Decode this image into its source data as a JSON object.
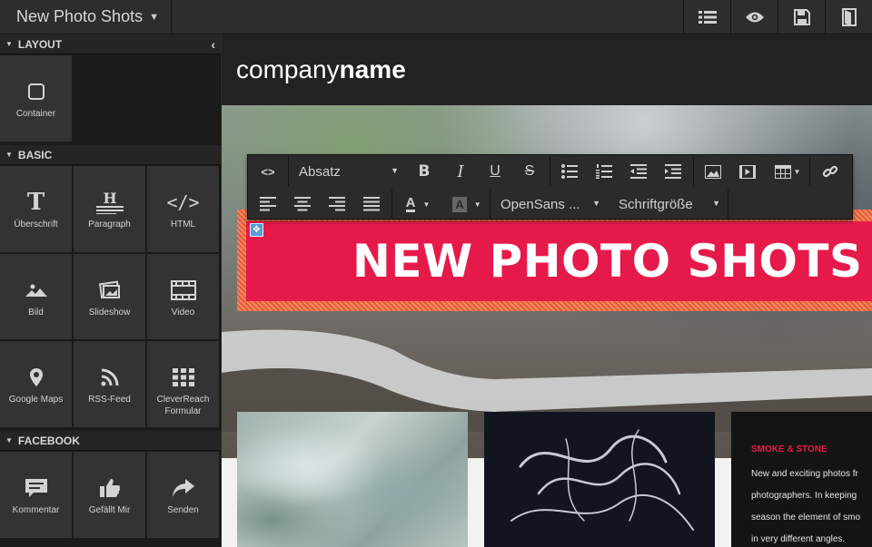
{
  "topbar": {
    "title": "New Photo Shots",
    "buttons": [
      {
        "icon": "list-icon"
      },
      {
        "icon": "eye-icon"
      },
      {
        "icon": "save-icon"
      },
      {
        "icon": "exit-icon"
      }
    ]
  },
  "sidebar": {
    "sections": [
      {
        "title": "LAYOUT",
        "items": [
          {
            "label": "Container",
            "icon": "container-icon"
          }
        ]
      },
      {
        "title": "BASIC",
        "items": [
          {
            "label": "Überschrift",
            "icon": "heading-icon"
          },
          {
            "label": "Paragraph",
            "icon": "paragraph-icon"
          },
          {
            "label": "HTML",
            "icon": "code-icon"
          },
          {
            "label": "Bild",
            "icon": "image-icon"
          },
          {
            "label": "Slideshow",
            "icon": "slideshow-icon"
          },
          {
            "label": "Video",
            "icon": "video-icon"
          },
          {
            "label": "Google Maps",
            "icon": "map-pin-icon"
          },
          {
            "label": "RSS-Feed",
            "icon": "rss-icon"
          },
          {
            "label": "CleverReach Formular",
            "icon": "grid-icon"
          }
        ]
      },
      {
        "title": "FACEBOOK",
        "items": [
          {
            "label": "Kommentar",
            "icon": "comment-icon"
          },
          {
            "label": "Gefällt Mir",
            "icon": "thumbs-up-icon"
          },
          {
            "label": "Senden",
            "icon": "share-icon"
          }
        ]
      }
    ]
  },
  "canvas": {
    "brand_regular": "company",
    "brand_bold": "name",
    "headline": "NEW PHOTO SHOTS",
    "card": {
      "title": "SMOKE & STONE",
      "lines": [
        "New and exciting photos fr",
        "photographers. In keeping",
        "season the element of smo",
        "in very different angles."
      ]
    }
  },
  "editor_toolbar": {
    "format_select": "Absatz",
    "font_select": "OpenSans ...",
    "size_select": "Schriftgröße",
    "text_color_label": "A",
    "bg_color_label": "A"
  },
  "colors": {
    "accent": "#e61a4a",
    "ui_dark": "#2d2d2d"
  }
}
